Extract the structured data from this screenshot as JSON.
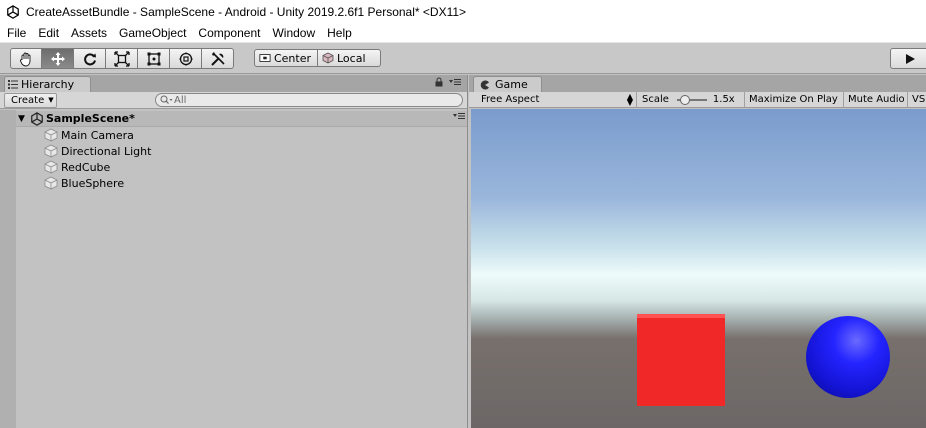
{
  "window": {
    "title": "CreateAssetBundle - SampleScene - Android - Unity 2019.2.6f1 Personal* <DX11>"
  },
  "menu": {
    "items": [
      "File",
      "Edit",
      "Assets",
      "GameObject",
      "Component",
      "Window",
      "Help"
    ]
  },
  "toolbar": {
    "tools": [
      "hand-tool",
      "move-tool",
      "rotate-tool",
      "scale-tool",
      "rect-tool",
      "transform-tool",
      "custom-tool"
    ],
    "active_tool": "move-tool",
    "pivot_mode": "Center",
    "pivot_rotation": "Local"
  },
  "hierarchy": {
    "tab_label": "Hierarchy",
    "create_label": "Create",
    "search_placeholder": "All",
    "scene_name": "SampleScene*",
    "items": [
      "Main Camera",
      "Directional Light",
      "RedCube",
      "BlueSphere"
    ]
  },
  "game": {
    "tab_label": "Game",
    "aspect": "Free Aspect",
    "scale_label": "Scale",
    "scale_value": "1.5x",
    "maximize_label": "Maximize On Play",
    "mute_label": "Mute Audio",
    "vsync_label": "VS",
    "colors": {
      "cube": "#f02828",
      "sphere": "#1e1eff"
    }
  }
}
